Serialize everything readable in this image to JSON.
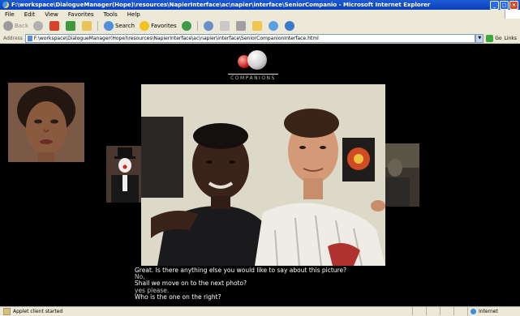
{
  "window": {
    "title": "F:\\workspace\\DialogueManager(Hope)\\resources\\NapierInterface\\ac\\napier\\interface\\SeniorCompanio - Microsoft Internet Explorer",
    "controls": [
      "_",
      "□",
      "×"
    ]
  },
  "menu": [
    "File",
    "Edit",
    "View",
    "Favorites",
    "Tools",
    "Help"
  ],
  "toolbar": {
    "back": "Back",
    "search": "Search",
    "favorites": "Favorites"
  },
  "address": {
    "label": "Address",
    "value": "F:\\workspace\\DialogueManager(Hope)\\resources\\NapierInterface\\ac\\napier\\interface\\SeniorCompanionInterface.html",
    "go": "Go",
    "links": "Links"
  },
  "logo": {
    "text": "COMPANIONS"
  },
  "dialogue": {
    "lines": [
      "Great. Is there anything else you would like to say about this picture?",
      "No,",
      "Shall we move on to the next photo?",
      "yes please.",
      "Who is the one on the right?"
    ]
  },
  "status": {
    "text": "Applet client started",
    "zone": "Internet"
  }
}
